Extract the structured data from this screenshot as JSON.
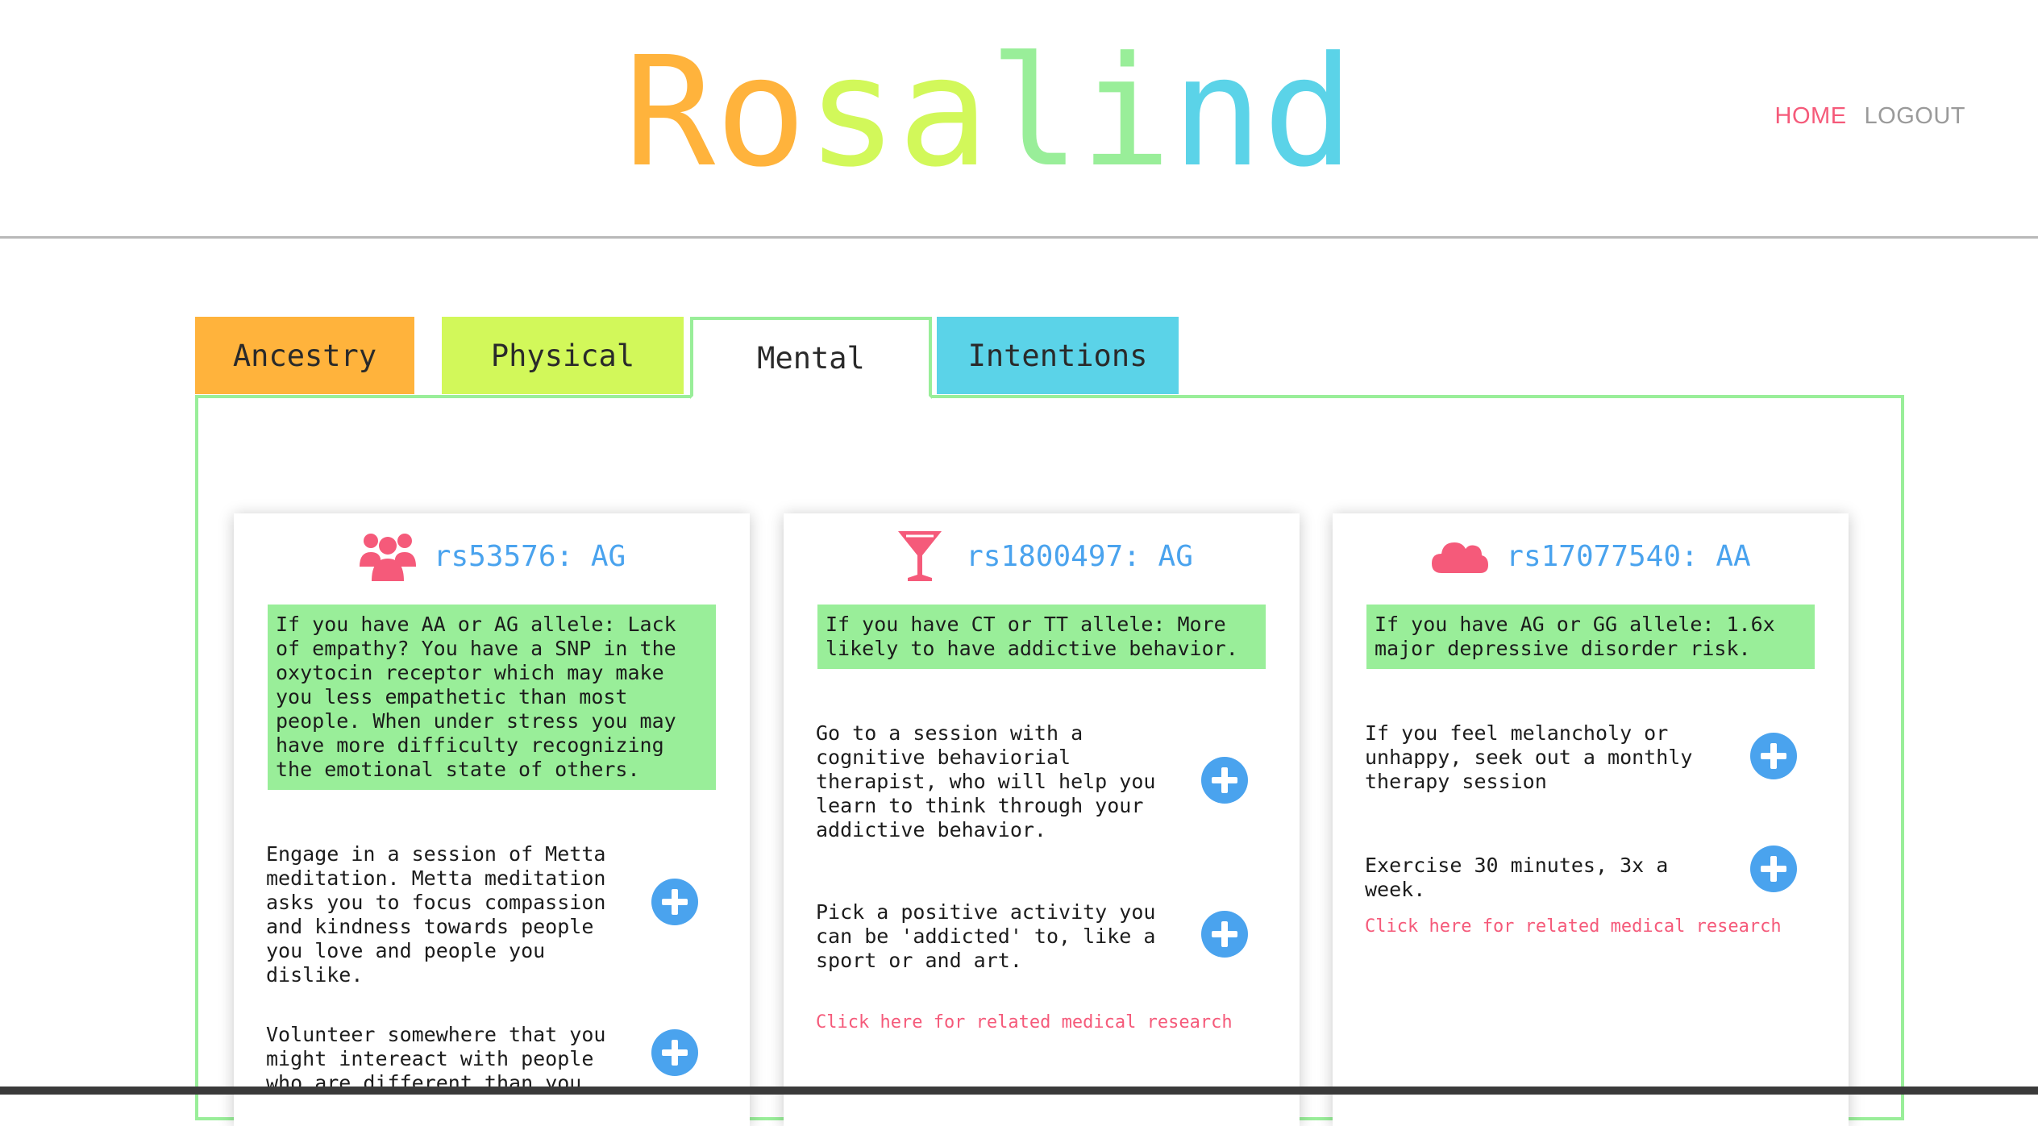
{
  "header": {
    "logo_letters": [
      {
        "char": "R",
        "color": "#ffb33c"
      },
      {
        "char": "o",
        "color": "#ffb33c"
      },
      {
        "char": "s",
        "color": "#d2f85a"
      },
      {
        "char": "a",
        "color": "#d2f85a"
      },
      {
        "char": "l",
        "color": "#99ee99"
      },
      {
        "char": "i",
        "color": "#99ee99"
      },
      {
        "char": "n",
        "color": "#5bd3e8"
      },
      {
        "char": "d",
        "color": "#5bd3e8"
      }
    ],
    "nav": {
      "home_label": "HOME",
      "logout_label": "LOGOUT",
      "home_color": "#f55a7a",
      "logout_color": "#9a9a9a"
    }
  },
  "tabs": [
    {
      "label": "Ancestry",
      "color": "#ffb33c",
      "active": false
    },
    {
      "label": "Physical",
      "color": "#d2f85a",
      "active": false
    },
    {
      "label": "Mental",
      "color": "#ffffff",
      "active": true
    },
    {
      "label": "Intentions",
      "color": "#5bd3e8",
      "active": false
    }
  ],
  "colors": {
    "accent_green": "#99ee99",
    "snp_blue": "#4aa3ee",
    "icon_pink": "#f55a7a",
    "link_pink": "#f55a7a"
  },
  "cards": [
    {
      "icon": "people-group-icon",
      "snp": "rs53576: AG",
      "risk": "If you have AA or AG allele: Lack of empathy? You have a SNP in the oxytocin receptor which may make you less empathetic than most people. When under stress you may have more difficulty recognizing the emotional state of others.",
      "actions": [
        {
          "text": "Engage in a session of Metta meditation. Metta meditation asks you to focus compassion and kindness towards people you love and people you dislike."
        },
        {
          "text": "Volunteer somewhere that you might intereact with people who are different than you."
        }
      ],
      "research_link": ""
    },
    {
      "icon": "cocktail-glass-icon",
      "snp": "rs1800497: AG",
      "risk": "If you have CT or TT allele: More likely to have addictive behavior.",
      "actions": [
        {
          "text": "Go to a session with a cognitive behaviorial therapist, who will help you learn to think through your addictive behavior."
        },
        {
          "text": "Pick a positive activity you can be 'addicted' to, like a sport or and art."
        }
      ],
      "research_link": "Click here for related medical research"
    },
    {
      "icon": "cloud-icon",
      "snp": "rs17077540: AA",
      "risk": "If you have AG or GG allele: 1.6x major depressive disorder risk.",
      "actions": [
        {
          "text": "If you feel melancholy or unhappy, seek out a monthly therapy session"
        },
        {
          "text": "Exercise 30 minutes, 3x a week."
        }
      ],
      "research_link": "Click here for related medical research"
    }
  ]
}
